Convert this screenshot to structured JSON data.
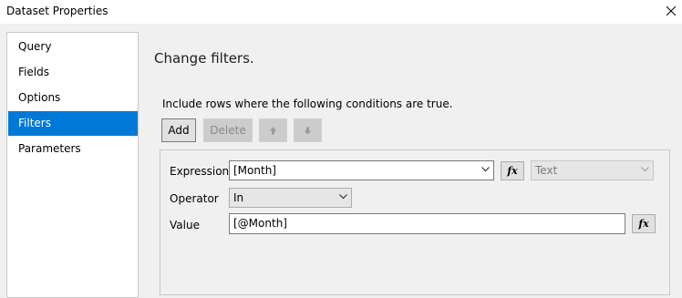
{
  "window": {
    "title": "Dataset Properties",
    "close_icon": "close-icon"
  },
  "sidebar": {
    "items": [
      {
        "label": "Query"
      },
      {
        "label": "Fields"
      },
      {
        "label": "Options"
      },
      {
        "label": "Filters",
        "selected": true
      },
      {
        "label": "Parameters"
      }
    ]
  },
  "main": {
    "title": "Change filters.",
    "instructions": "Include rows where the following conditions are true.",
    "toolbar": {
      "add_label": "Add",
      "delete_label": "Delete",
      "move_up_icon": "arrow-up-icon",
      "move_down_icon": "arrow-down-icon"
    },
    "filter": {
      "expression_label": "Expression",
      "expression_value": "[Month]",
      "type_value": "Text",
      "operator_label": "Operator",
      "operator_value": "In",
      "value_label": "Value",
      "value_value": "[@Month]",
      "fx_label": "fx"
    }
  },
  "colors": {
    "selection": "#0078d7",
    "background": "#f0f0f0"
  }
}
